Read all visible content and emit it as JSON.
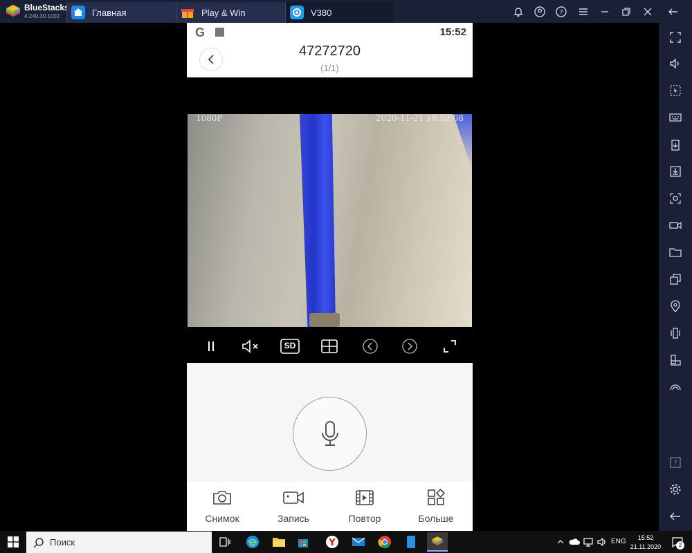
{
  "bluestacks": {
    "name": "BlueStacks",
    "version": "4.240.30.1002",
    "tabs": [
      {
        "label": "Главная",
        "icon": "home-icon"
      },
      {
        "label": "Play & Win",
        "icon": "gift-icon"
      },
      {
        "label": "V380",
        "icon": "v380-app-icon"
      }
    ],
    "window_buttons": [
      "bell-icon",
      "account-icon",
      "help-icon",
      "menu-icon",
      "minimize-icon",
      "restore-icon",
      "close-icon"
    ],
    "sidebar_icons": [
      "fullscreen-icon",
      "volume-icon",
      "pointer-icon",
      "keyboard-icon",
      "install-apk-icon",
      "media-manager-icon",
      "screenshot-icon",
      "record-icon",
      "folder-icon",
      "multi-instance-icon",
      "location-icon",
      "shake-icon",
      "rotate-icon",
      "macro-icon",
      "help-icon",
      "settings-icon",
      "back-icon"
    ]
  },
  "app": {
    "status_time": "15:52",
    "device_title": "47272720",
    "device_page": "(1/1)",
    "video": {
      "resolution_osd": "1080P",
      "timestamp_osd": "2020-11-21  18:52:08"
    },
    "controls": [
      "pause-icon",
      "mute-icon",
      "sd-quality-button",
      "split-screen-icon",
      "previous-icon",
      "next-icon",
      "fullscreen-icon"
    ],
    "quality_label": "SD",
    "actions": [
      {
        "label": "Снимок",
        "icon": "camera-icon"
      },
      {
        "label": "Запись",
        "icon": "video-record-icon"
      },
      {
        "label": "Повтор",
        "icon": "playback-icon"
      },
      {
        "label": "Больше",
        "icon": "more-apps-icon"
      }
    ]
  },
  "taskbar": {
    "search_placeholder": "Поиск",
    "language": "ENG",
    "time": "15:52",
    "date": "21.11.2020",
    "notification_count": "2"
  },
  "colors": {
    "titlebar": "#1a2036",
    "tape_blue": "#2c3ed0",
    "panel_bg": "#f6f6f6"
  }
}
